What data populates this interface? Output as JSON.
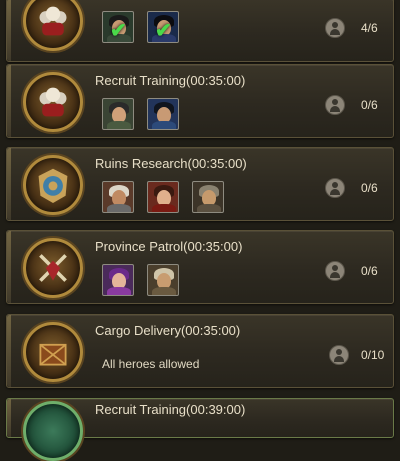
{
  "tasks": [
    {
      "title": "",
      "emblem": "arab-heroes-emblem-icon",
      "heroes": [
        {
          "name": "hero-portrait-1",
          "status": "assigned",
          "palette": [
            "#2a3a2c",
            "#c79a72",
            "#1a1a1a",
            "#3a4a3a"
          ]
        },
        {
          "name": "hero-portrait-2",
          "status": "assigned",
          "palette": [
            "#1a2a4a",
            "#c79a72",
            "#0c0c10",
            "#2a3a6a"
          ]
        }
      ],
      "count": "4/6"
    },
    {
      "title": "Recruit Training(00:35:00)",
      "emblem": "arab-heroes-emblem-icon",
      "heroes": [
        {
          "name": "hero-portrait-1",
          "palette": [
            "#3a4434",
            "#d0a079",
            "#2a2a2a",
            "#4a5a40"
          ]
        },
        {
          "name": "hero-portrait-2",
          "palette": [
            "#22345a",
            "#c89a74",
            "#10151e",
            "#2c4a7a"
          ]
        }
      ],
      "count": "0/6"
    },
    {
      "title": "Ruins Research(00:35:00)",
      "emblem": "gear-shield-emblem-icon",
      "heroes": [
        {
          "name": "hero-portrait-1",
          "palette": [
            "#5a3a2a",
            "#c08a62",
            "#dcd6c8",
            "#6a6a6a"
          ]
        },
        {
          "name": "hero-portrait-2",
          "palette": [
            "#6a2a1e",
            "#e0b08c",
            "#3a1a10",
            "#7a1a12"
          ]
        },
        {
          "name": "hero-portrait-3",
          "palette": [
            "#3c3428",
            "#c69a6c",
            "#8a8270",
            "#5a5040"
          ]
        }
      ],
      "count": "0/6"
    },
    {
      "title": "Province Patrol(00:35:00)",
      "emblem": "crossed-swords-emblem-icon",
      "heroes": [
        {
          "name": "hero-portrait-1",
          "palette": [
            "#4a2a5a",
            "#e4b49a",
            "#6a2a8a",
            "#8a3aa0"
          ]
        },
        {
          "name": "hero-portrait-2",
          "palette": [
            "#4a3e2c",
            "#c89c70",
            "#cfc4a8",
            "#6a5a40"
          ]
        }
      ],
      "count": "0/6"
    },
    {
      "title": "Cargo Delivery(00:35:00)",
      "emblem": "cargo-crate-emblem-icon",
      "note": "All heroes allowed",
      "count": "0/10"
    },
    {
      "title": "Recruit Training(00:39:00)",
      "emblem": "green-emblem-icon"
    }
  ],
  "colors": {
    "title": "#e8dfc8",
    "check": "#4ad94a",
    "emblem_rim": "#b08a3c"
  }
}
